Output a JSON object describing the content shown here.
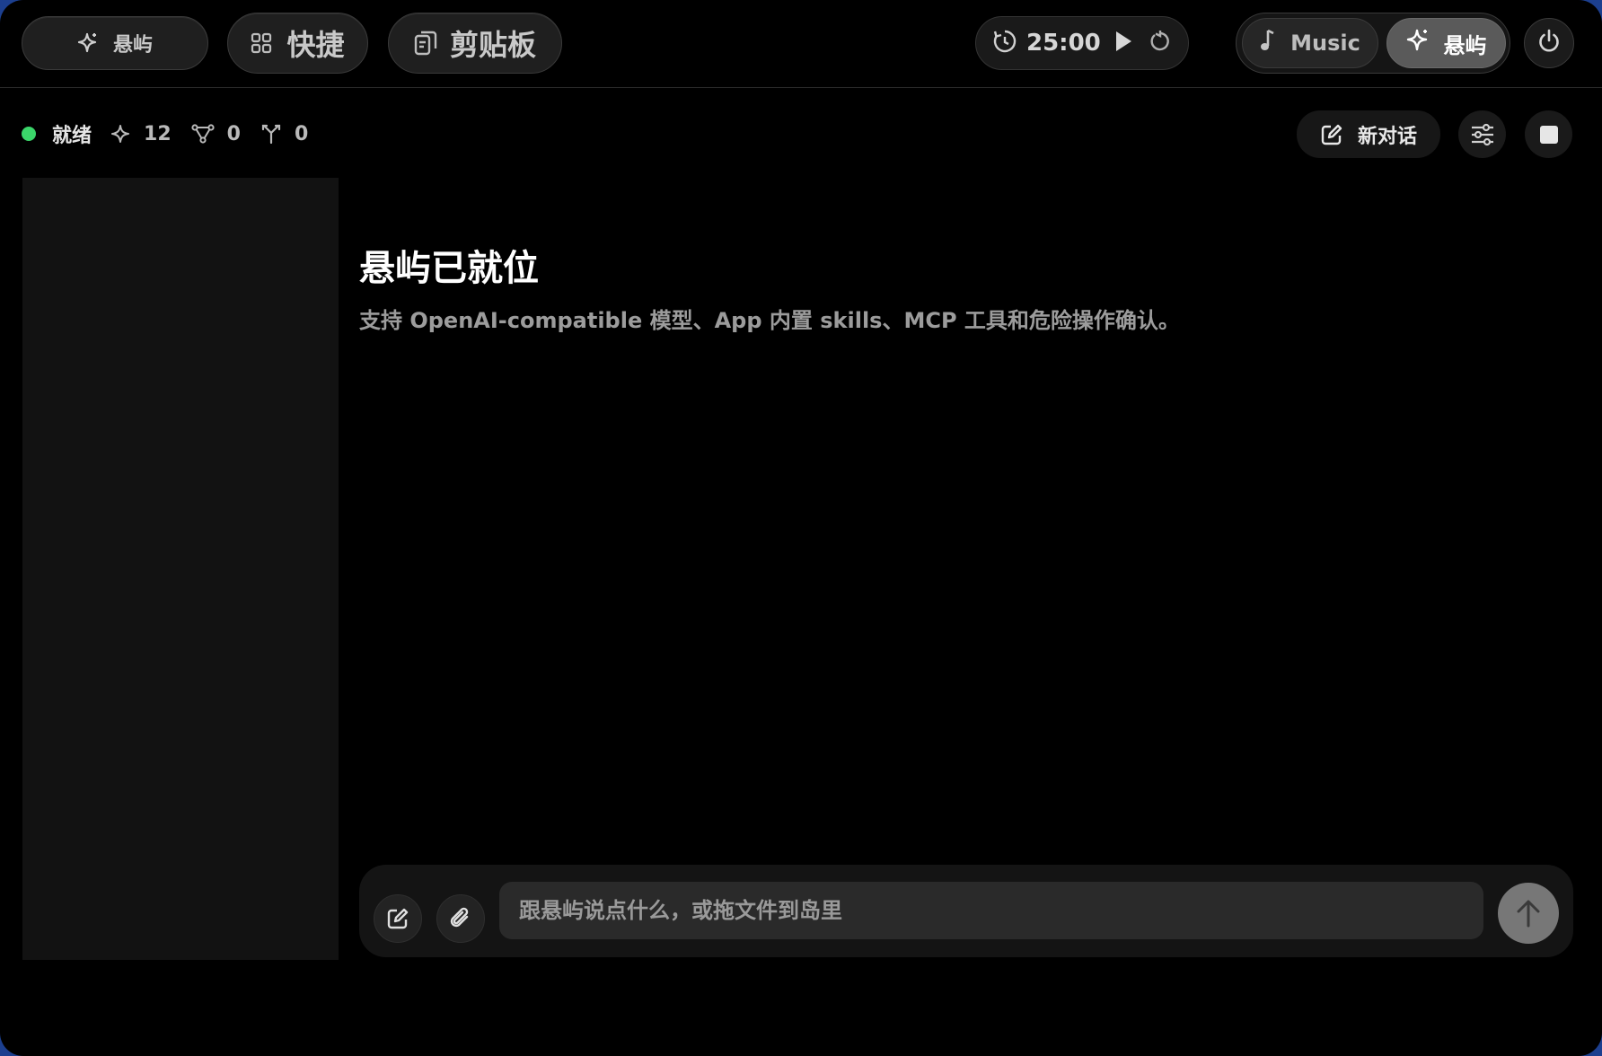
{
  "topbar": {
    "island_label": "悬屿",
    "shortcuts_label": "快捷",
    "clipboard_label": "剪贴板",
    "timer": {
      "time": "25:00"
    },
    "mode_switch": {
      "music_label": "Music",
      "island_label": "悬屿"
    }
  },
  "status": {
    "ready_label": "就绪",
    "skills_count": "12",
    "mcp_count": "0",
    "branch_count": "0",
    "indicator_color": "#3bd66a"
  },
  "actions": {
    "new_chat_label": "新对话"
  },
  "hero": {
    "title": "悬屿已就位",
    "subtitle": "支持 OpenAI-compatible 模型、App 内置 skills、MCP 工具和危险操作确认。"
  },
  "composer": {
    "placeholder": "跟悬屿说点什么，或拖文件到岛里",
    "value": ""
  },
  "icons": {
    "sparkle": "sparkle-icon",
    "grid": "grid-icon",
    "clipboard": "clipboard-icon",
    "timer": "timer-icon",
    "play": "play-icon",
    "reset": "reset-icon",
    "music": "music-note-icon",
    "power": "power-icon",
    "nodes": "nodes-icon",
    "branch": "branch-icon",
    "edit": "edit-icon",
    "sliders": "sliders-icon",
    "stop": "stop-icon",
    "attach": "paperclip-icon",
    "send": "arrow-up-icon"
  }
}
